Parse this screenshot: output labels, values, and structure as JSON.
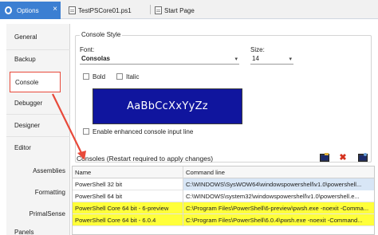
{
  "tabs": [
    {
      "label": "Options",
      "icon": "gear-icon",
      "active": true
    },
    {
      "label": "TestPSCore01.ps1",
      "icon": "document-icon"
    },
    {
      "label": "Start Page",
      "icon": "document-icon"
    }
  ],
  "tab_close": "×",
  "sidebar": {
    "items": [
      {
        "label": "General"
      },
      {
        "label": "Backup"
      },
      {
        "label": "Console",
        "selected": true
      },
      {
        "label": "Debugger"
      },
      {
        "label": "Designer"
      },
      {
        "label": "Editor"
      },
      {
        "label": "Assemblies"
      },
      {
        "label": "Formatting"
      },
      {
        "label": "PrimalSense"
      },
      {
        "label": "Panels"
      }
    ]
  },
  "console_style": {
    "group_title": "Console Style",
    "font_label": "Font:",
    "font_value": "Consolas",
    "size_label": "Size:",
    "size_value": "14",
    "bold_label": "Bold",
    "italic_label": "Italic",
    "preview_text": "AaBbCcXxYyZz",
    "preview_bg": "#10159e",
    "enhanced_label": "Enable enhanced console input line"
  },
  "consoles": {
    "header": "Consoles (Restart required to apply changes)",
    "columns": [
      "Name",
      "Command line"
    ],
    "rows": [
      {
        "name": "PowerShell 32 bit",
        "command": "C:\\WINDOWS\\SysWOW64\\windowspowershell\\v1.0\\powershell...",
        "highlight": false,
        "selected": true
      },
      {
        "name": "PowerShell 64 bit",
        "command": "C:\\WINDOWS\\system32\\windowspowershell\\v1.0\\powershell.e...",
        "highlight": false,
        "selected": false
      },
      {
        "name": "PowerShell Core 64 bit - 6-preview",
        "command": "C:\\Program Files\\PowerShell\\6-preview\\pwsh.exe -noexit -Comma...",
        "highlight": true,
        "selected": false
      },
      {
        "name": "PowerShell Core 64 bit - 6.0.4",
        "command": "C:\\Program Files\\PowerShell\\6.0.4\\pwsh.exe -noexit -Command...",
        "highlight": true,
        "selected": false
      }
    ],
    "toolbar": [
      {
        "icon": "add-console-icon"
      },
      {
        "icon": "delete-icon"
      },
      {
        "icon": "edit-console-icon"
      }
    ]
  },
  "colors": {
    "accent": "#3c7fd2",
    "annotation_red": "#e8493a",
    "highlight_yellow": "#ffff3a"
  }
}
